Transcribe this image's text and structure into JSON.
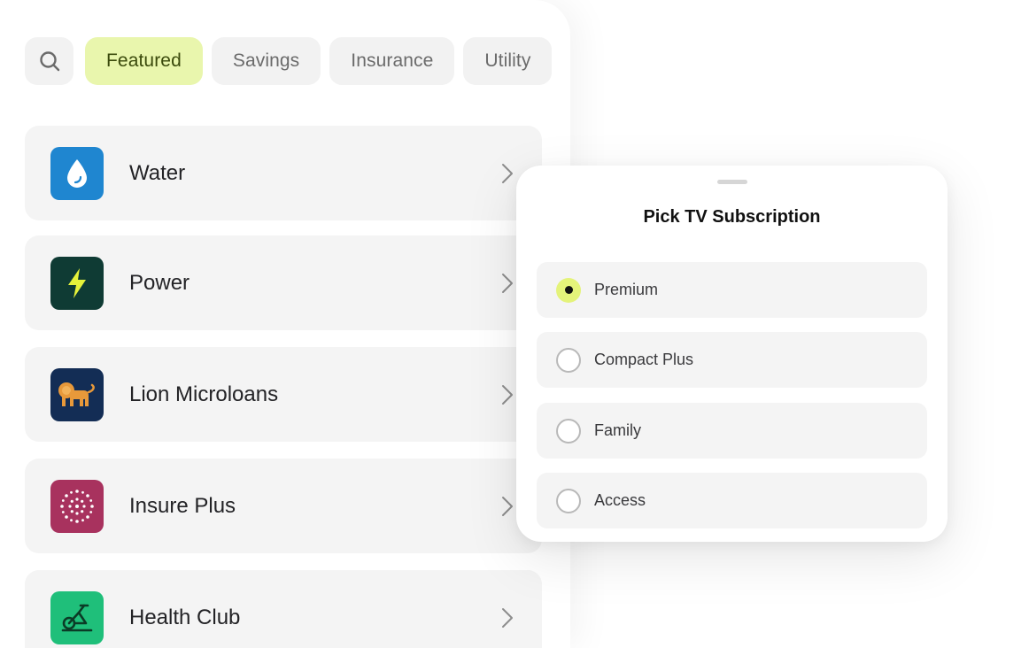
{
  "filters": {
    "search_icon": "search-icon",
    "chips": [
      {
        "label": "Featured",
        "active": true
      },
      {
        "label": "Savings",
        "active": false
      },
      {
        "label": "Insurance",
        "active": false
      },
      {
        "label": "Utility",
        "active": false
      }
    ]
  },
  "services": [
    {
      "label": "Water",
      "icon": "water-drop-icon",
      "color": "#1f86d0"
    },
    {
      "label": "Power",
      "icon": "lightning-bolt-icon",
      "color": "#0f3b34"
    },
    {
      "label": "Lion Microloans",
      "icon": "lion-icon",
      "color": "#132d55"
    },
    {
      "label": "Insure Plus",
      "icon": "radial-dots-icon",
      "color": "#a8325e"
    },
    {
      "label": "Health Club",
      "icon": "exercise-bike-icon",
      "color": "#1fbf7a"
    }
  ],
  "sheet": {
    "title": "Pick TV Subscription",
    "options": [
      {
        "label": "Premium",
        "selected": true
      },
      {
        "label": "Compact Plus",
        "selected": false
      },
      {
        "label": "Family",
        "selected": false
      },
      {
        "label": "Access",
        "selected": false
      }
    ],
    "accent": "#e4f37a"
  }
}
